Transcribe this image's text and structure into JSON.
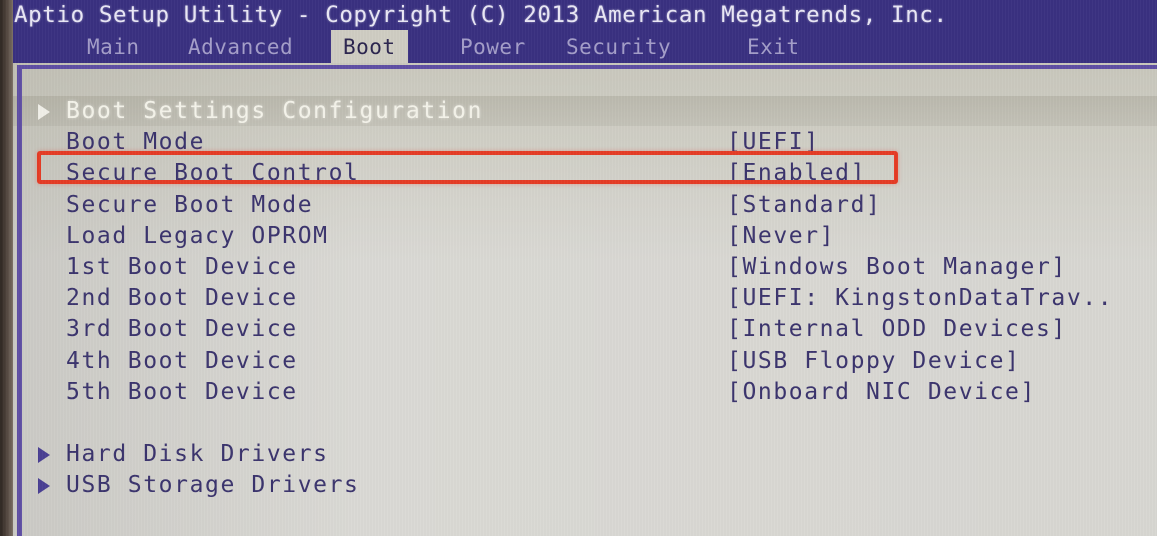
{
  "titlebar": {
    "text": "Aptio Setup Utility - Copyright (C) 2013 American Megatrends, Inc."
  },
  "menubar": {
    "items": [
      {
        "label": "Main",
        "active": false
      },
      {
        "label": "Advanced",
        "active": false
      },
      {
        "label": "Boot",
        "active": true
      },
      {
        "label": "Power",
        "active": false
      },
      {
        "label": "Security",
        "active": false
      },
      {
        "label": "Exit",
        "active": false
      }
    ]
  },
  "settings": {
    "rows": [
      {
        "label": "Boot Settings Configuration",
        "value": "",
        "arrow": true,
        "selected": true
      },
      {
        "label": "Boot Mode",
        "value": "[UEFI]",
        "arrow": false,
        "selected": false
      },
      {
        "label": "Secure Boot Control",
        "value": "[Enabled]",
        "arrow": false,
        "selected": false,
        "highlighted": true
      },
      {
        "label": "Secure Boot Mode",
        "value": "[Standard]",
        "arrow": false,
        "selected": false
      },
      {
        "label": "Load Legacy OPROM",
        "value": "[Never]",
        "arrow": false,
        "selected": false
      },
      {
        "label": "1st Boot Device",
        "value": "[Windows Boot Manager]",
        "arrow": false,
        "selected": false
      },
      {
        "label": "2nd Boot Device",
        "value": "[UEFI: KingstonDataTrav..",
        "arrow": false,
        "selected": false
      },
      {
        "label": "3rd Boot Device",
        "value": "[Internal ODD Devices]",
        "arrow": false,
        "selected": false
      },
      {
        "label": "4th Boot Device",
        "value": "[USB Floppy Device]",
        "arrow": false,
        "selected": false
      },
      {
        "label": "5th Boot Device",
        "value": "[Onboard NIC Device]",
        "arrow": false,
        "selected": false
      }
    ],
    "submenus": [
      {
        "label": "Hard Disk Drivers",
        "arrow": true
      },
      {
        "label": "USB Storage Drivers",
        "arrow": true
      }
    ]
  },
  "annotation": {
    "target_row_label": "Secure Boot Control",
    "target_row_value": "[Enabled]",
    "box_color": "#ec3a22"
  },
  "colors": {
    "header_bg": "#3a3185",
    "header_text": "#e9e7f6",
    "menu_inactive_text": "#a49ecb",
    "active_tab_bg": "#cfcdc2",
    "active_tab_text": "#2b2550",
    "screen_bg": "#d6d5d0",
    "body_text": "#3b3470",
    "selected_text": "#f4f3ea",
    "frame_line": "#5f4fa8",
    "annotation": "#ec3a22"
  }
}
